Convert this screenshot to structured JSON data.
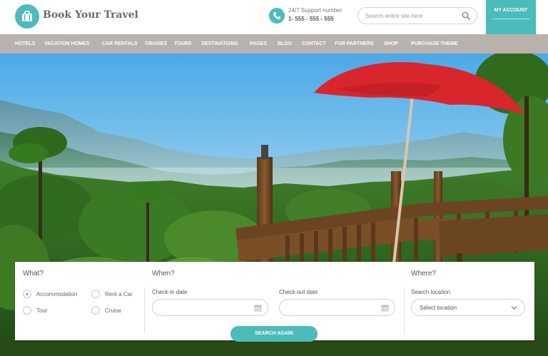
{
  "header": {
    "logo_text": "Book Your Travel",
    "support_label": "24/7 Support number",
    "support_phone": "1- 555 - 555 - 555",
    "search_placeholder": "Search entire site here",
    "account_label": "MY ACCOUNT"
  },
  "nav": {
    "items": [
      "HOTELS",
      "VACATION HOMES",
      "CAR RENTALS",
      "CRUISES",
      "TOURS",
      "DESTINATIONS",
      "PAGES",
      "BLOG",
      "CONTACT",
      "FOR PARTNERS",
      "SHOP",
      "PURCHASE THEME"
    ]
  },
  "search": {
    "what_title": "What?",
    "when_title": "When?",
    "where_title": "Where?",
    "options": [
      "Accommodation",
      "Rent a Car",
      "Tour",
      "Cruise"
    ],
    "selected_option": "Accommodation",
    "checkin_label": "Check-in date",
    "checkout_label": "Check-out date",
    "location_label": "Search location",
    "location_select": "Select location",
    "button_label": "SEARCH AGAIN"
  },
  "colors": {
    "accent": "#4bbcbc",
    "nav_bg": "#b9b2ac",
    "umbrella": "#d8262c"
  },
  "icons": {
    "logo": "suitcase-icon",
    "support": "phone-icon",
    "search": "search-icon",
    "calendar": "calendar-icon",
    "dropdown": "chevron-down-icon"
  }
}
